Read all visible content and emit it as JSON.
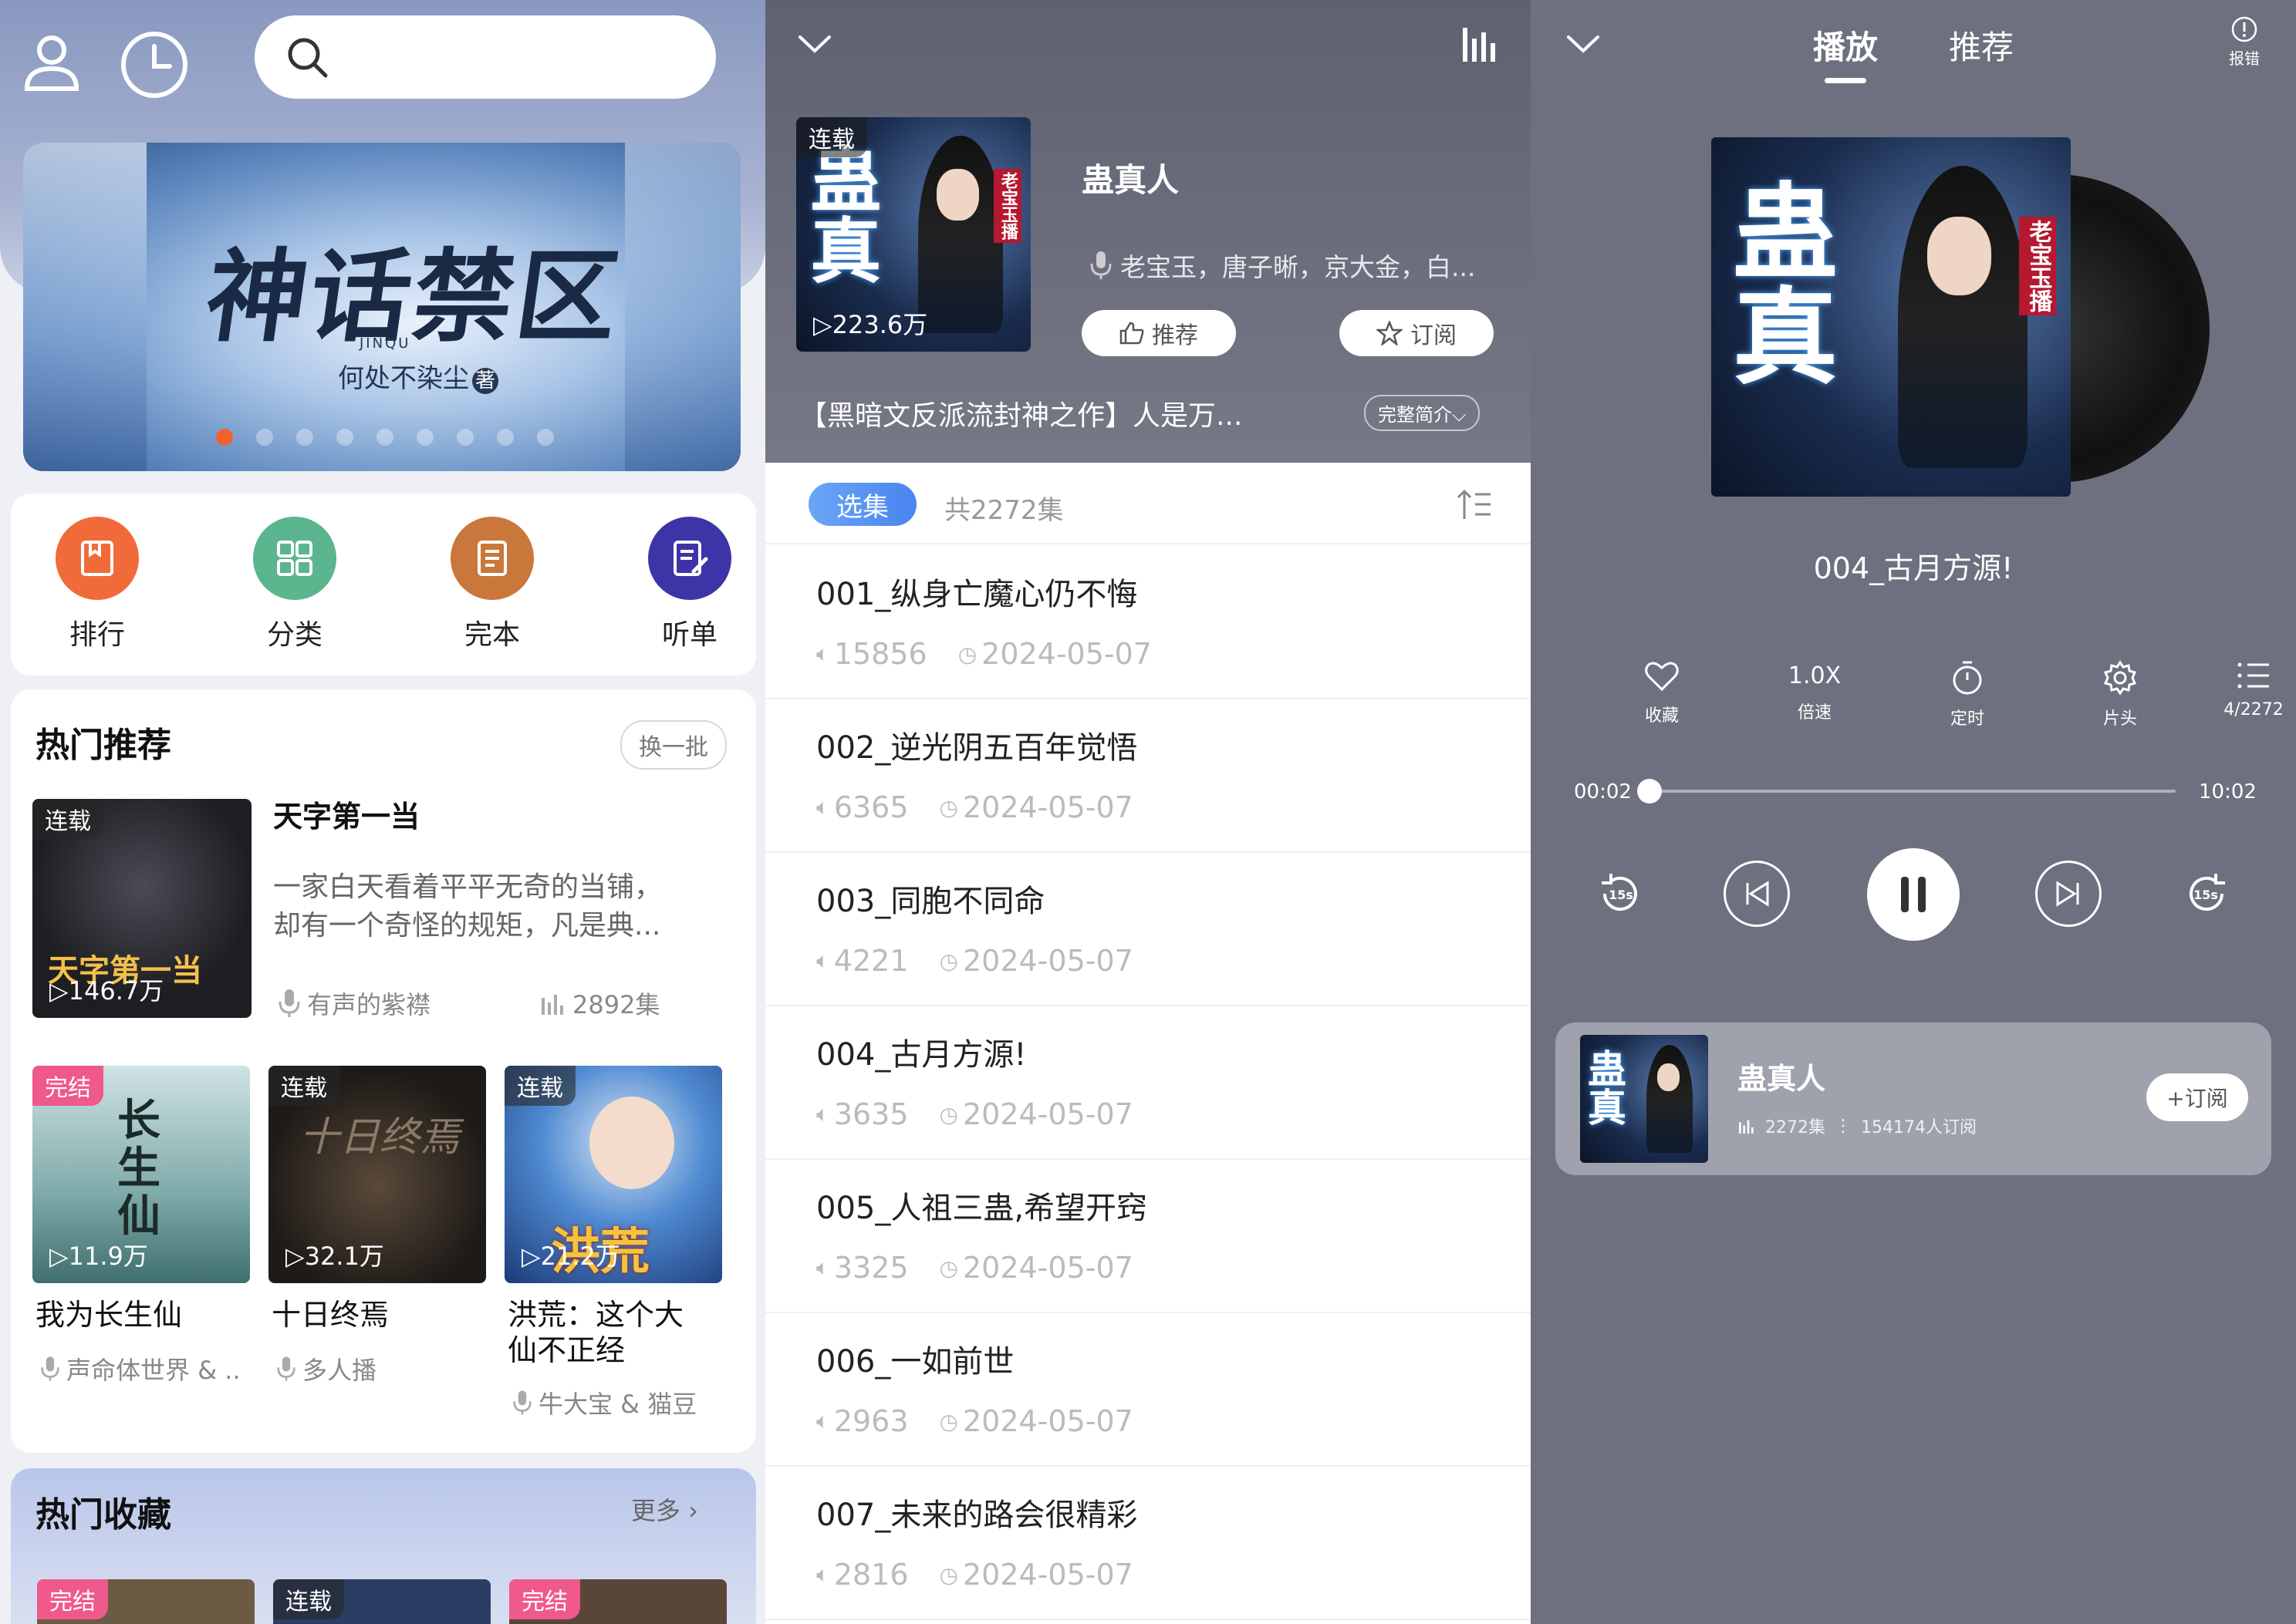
{
  "home": {
    "search": {
      "placeholder": ""
    },
    "banner": {
      "title": "神话禁区",
      "subtitle": "何处不染尘",
      "author_mark": "著",
      "pinyin": "JINQU"
    },
    "categories": [
      {
        "label": "排行",
        "color": "#f16b3a",
        "icon": "book-icon"
      },
      {
        "label": "分类",
        "color": "#5bb58e",
        "icon": "grid-icon"
      },
      {
        "label": "完本",
        "color": "#c9773a",
        "icon": "document-icon"
      },
      {
        "label": "听单",
        "color": "#3d34a8",
        "icon": "list-edit-icon"
      }
    ],
    "hot": {
      "title": "热门推荐",
      "refresh": "换一批",
      "featured": {
        "tag": "连载",
        "plays": "146.7万",
        "title": "天字第一当",
        "desc_line1": "一家白天看着平平无奇的当铺，",
        "desc_line2": "却有一个奇怪的规矩，凡是典...",
        "narrator": "有声的紫襟",
        "episodes": "2892集"
      },
      "grid": [
        {
          "tag": "完结",
          "plays": "11.9万",
          "title": "我为长生仙",
          "title2": "",
          "narrator": "声命体世界 & ..",
          "art": "长生仙"
        },
        {
          "tag": "连载",
          "plays": "32.1万",
          "title": "十日终焉",
          "title2": "",
          "narrator": "多人播",
          "art": "十日终焉"
        },
        {
          "tag": "连载",
          "plays": "21.2万",
          "title": "洪荒：这个大",
          "title2": "仙不正经",
          "narrator": "牛大宝 & 猫豆",
          "art": "洪荒"
        }
      ]
    },
    "collect": {
      "title": "热门收藏",
      "more": "更多",
      "tags": [
        "完结",
        "连载",
        "完结"
      ]
    }
  },
  "detail": {
    "tag": "连载",
    "plays": "223.6万",
    "title": "蛊真人",
    "authors": "老宝玉，唐子晰，京大金，白...",
    "recommend": "推荐",
    "subscribe": "订阅",
    "desc": "【黑暗文反派流封神之作】人是万...",
    "intro_btn": "完整简介",
    "select_label": "选集",
    "total": "共2272集",
    "episodes": [
      {
        "name": "001_纵身亡魔心仍不悔",
        "plays": "15856",
        "date": "2024-05-07"
      },
      {
        "name": "002_逆光阴五百年觉悟",
        "plays": "6365",
        "date": "2024-05-07"
      },
      {
        "name": "003_同胞不同命",
        "plays": "4221",
        "date": "2024-05-07"
      },
      {
        "name": "004_古月方源!",
        "plays": "3635",
        "date": "2024-05-07"
      },
      {
        "name": "005_人祖三蛊,希望开窍",
        "plays": "3325",
        "date": "2024-05-07"
      },
      {
        "name": "006_一如前世",
        "plays": "2963",
        "date": "2024-05-07"
      },
      {
        "name": "007_未来的路会很精彩",
        "plays": "2816",
        "date": "2024-05-07"
      }
    ]
  },
  "player": {
    "tabs": [
      "播放",
      "推荐"
    ],
    "report": "报错",
    "track": "004_古月方源!",
    "controls": [
      {
        "icon": "heart-icon",
        "label": "收藏",
        "value": ""
      },
      {
        "icon": "speed-icon",
        "label": "倍速",
        "value": "1.0X"
      },
      {
        "icon": "timer-icon",
        "label": "定时",
        "value": ""
      },
      {
        "icon": "gear-icon",
        "label": "片头",
        "value": ""
      },
      {
        "icon": "list-icon",
        "label": "4/2272",
        "value": ""
      }
    ],
    "elapsed": "00:02",
    "duration": "10:02",
    "progress": 0.003,
    "rewind": "15s",
    "forward": "15s",
    "mini": {
      "title": "蛊真人",
      "episodes": "2272集",
      "subscribers": "154174人订阅",
      "subscribe": "+订阅"
    },
    "cover_side": "老宝玉播"
  },
  "colors": {
    "accent_orange": "#f0622f",
    "accent_blue": "#4a84ef",
    "player_bg": "#6d707e"
  }
}
